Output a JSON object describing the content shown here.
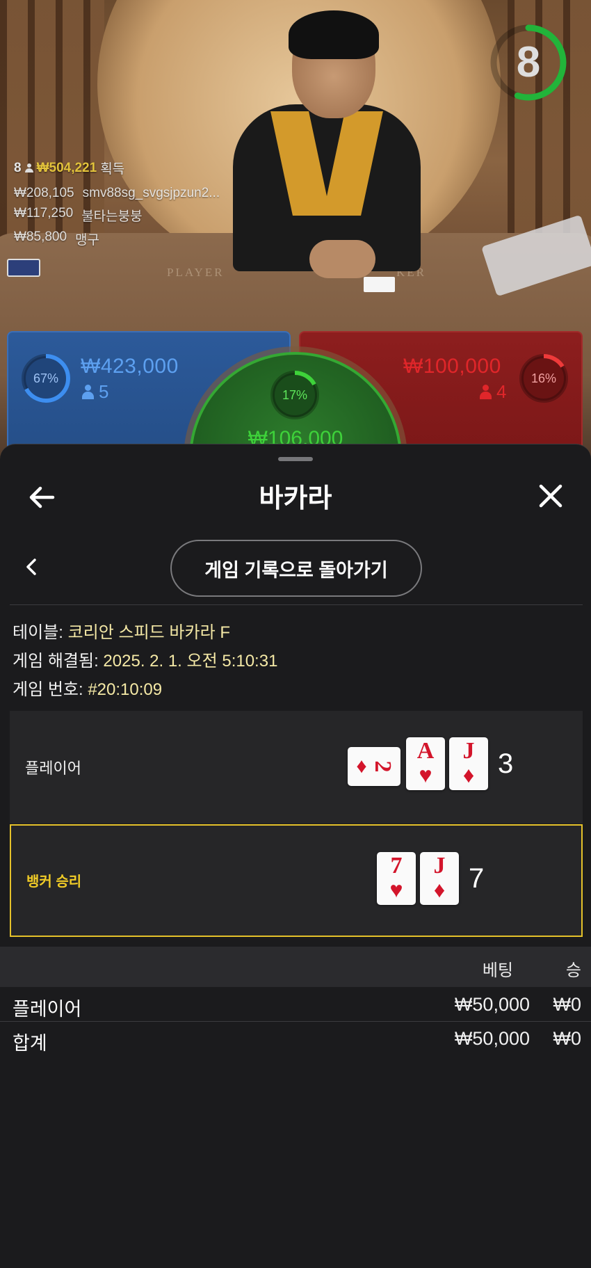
{
  "video": {
    "countdown": "8",
    "countdown_fraction": 0.55,
    "felt_player": "PLAYER",
    "felt_banker": "KER",
    "winners": {
      "count": "8",
      "total": "₩504,221",
      "label": "획득",
      "rows": [
        {
          "amount": "₩208,105",
          "name": "smv88sg_svgsjpzun2..."
        },
        {
          "amount": "₩117,250",
          "name": "불타는붕붕"
        },
        {
          "amount": "₩85,800",
          "name": "맹구"
        }
      ]
    },
    "player_spot": {
      "percent": "67%",
      "percent_value": 0.67,
      "amount": "₩423,000",
      "players": "5"
    },
    "banker_spot": {
      "percent": "16%",
      "percent_value": 0.16,
      "amount": "₩100,000",
      "players": "4"
    },
    "tie_spot": {
      "percent": "17%",
      "percent_value": 0.17,
      "amount": "₩106,000"
    },
    "colors": {
      "player": "#2c5a9a",
      "banker": "#8d1e1e",
      "tie": "#2d7c2c",
      "timer": "#22b43a"
    }
  },
  "sheet": {
    "title": "바카라",
    "back_icon": "arrow-left-icon",
    "close_icon": "close-icon",
    "history_button": "게임 기록으로 돌아가기",
    "info": {
      "table_label": "테이블:",
      "table_value": "코리안 스피드 바카라 F",
      "resolved_label": "게임 해결됨:",
      "resolved_value": "2025. 2. 1. 오전 5:10:31",
      "number_label": "게임 번호:",
      "number_value": "#20:10:09"
    },
    "player_result": {
      "label": "플레이어",
      "score": "3",
      "cards": [
        {
          "rank": "2",
          "suit": "♦"
        },
        {
          "rank": "A",
          "suit": "♥"
        },
        {
          "rank": "J",
          "suit": "♦"
        }
      ]
    },
    "banker_result": {
      "label": "뱅커 승리",
      "score": "7",
      "cards": [
        {
          "rank": "7",
          "suit": "♥"
        },
        {
          "rank": "J",
          "suit": "♦"
        }
      ]
    },
    "bets": {
      "header_bet": "베팅",
      "header_win": "승",
      "rows": [
        {
          "name": "플레이어",
          "bet": "₩50,000",
          "win": "₩0"
        },
        {
          "name": "합계",
          "bet": "₩50,000",
          "win": "₩0"
        }
      ]
    },
    "highlight_color": "#e5c22a"
  }
}
